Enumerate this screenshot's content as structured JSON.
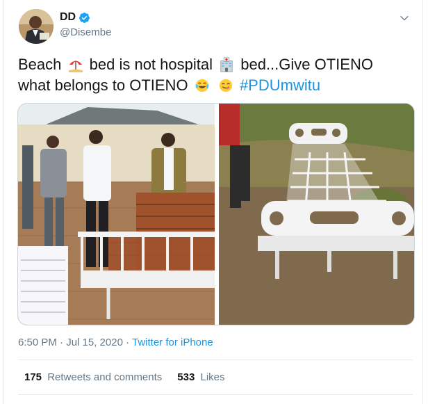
{
  "tweet": {
    "display_name": "DD",
    "handle": "@Disembe",
    "text_parts": {
      "p1": "Beach",
      "p2": "bed is not hospital",
      "p3": "bed...Give OTIENO",
      "p4": "what belongs to OTIENO",
      "hashtag": "#PDUmwitu"
    },
    "emojis": [
      "beach-umbrella-icon",
      "hospital-icon",
      "face-with-tears-of-joy-icon",
      "face-savoring-food-icon"
    ],
    "timestamp": "6:50 PM · Jul 15, 2020 · ",
    "source": "Twitter for iPhone",
    "retweets_count": "175",
    "retweets_label": "Retweets and comments",
    "likes_count": "533",
    "likes_label": "Likes"
  },
  "colors": {
    "link": "#1b95e0",
    "muted": "#657786",
    "text": "#14171a",
    "verified": "#1da1f2"
  }
}
